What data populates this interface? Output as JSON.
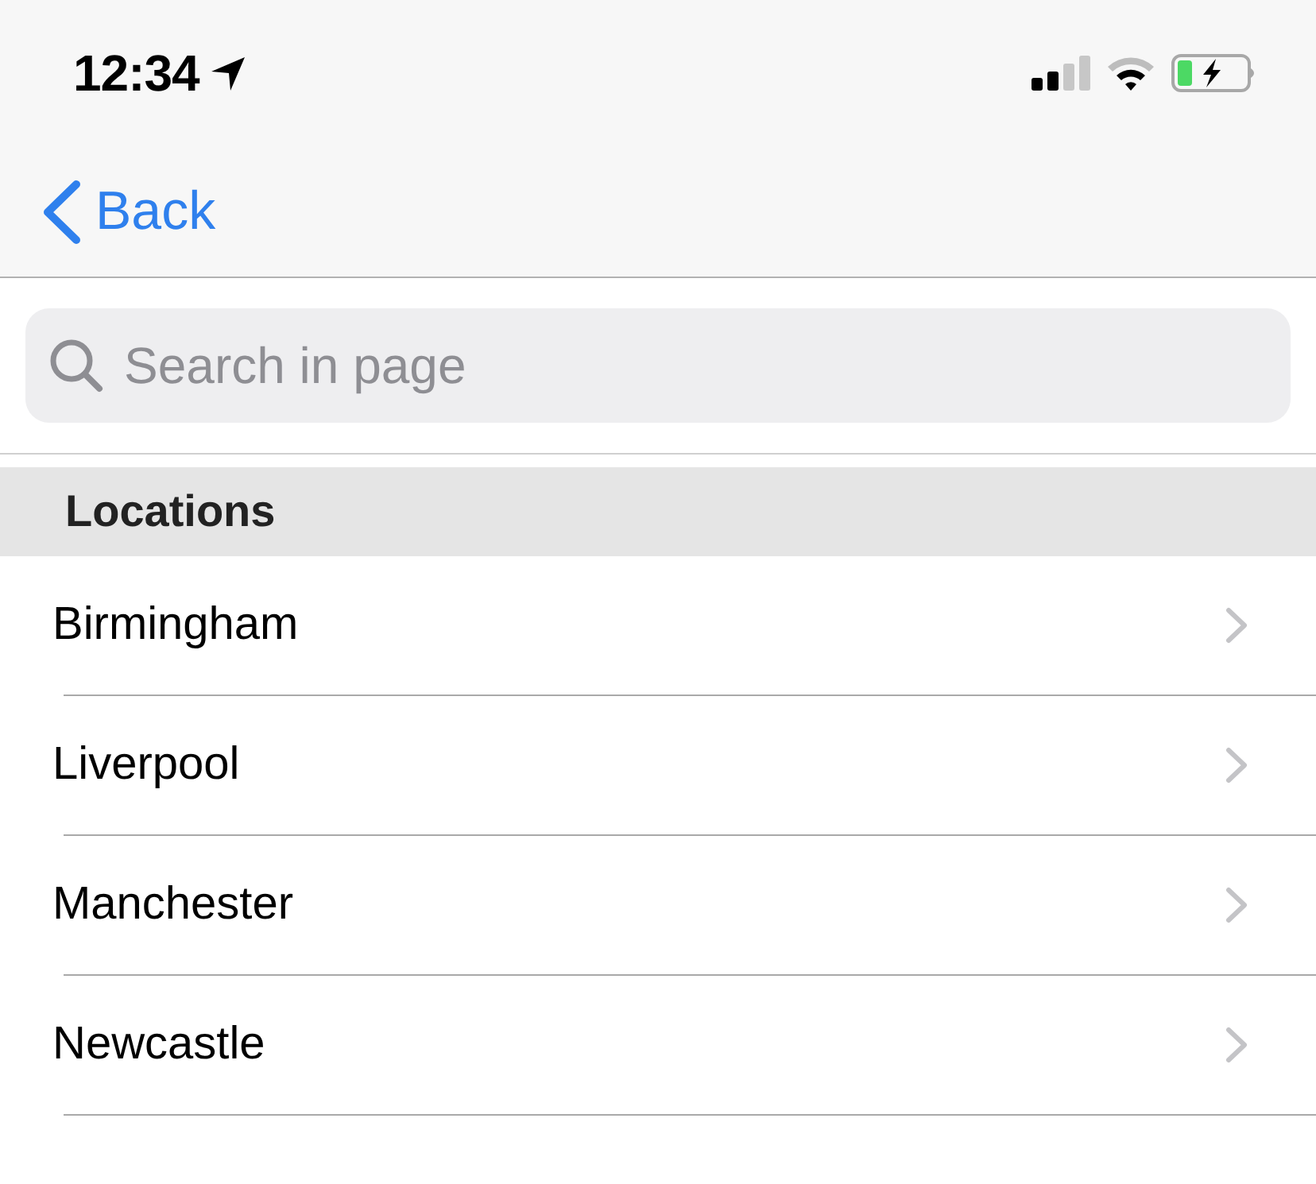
{
  "status_bar": {
    "time": "12:34"
  },
  "nav_bar": {
    "back_label": "Back"
  },
  "search": {
    "placeholder": "Search in page"
  },
  "sections": [
    {
      "title": "Locations",
      "items": [
        {
          "label": "Birmingham"
        },
        {
          "label": "Liverpool"
        },
        {
          "label": "Manchester"
        },
        {
          "label": "Newcastle"
        }
      ]
    }
  ]
}
